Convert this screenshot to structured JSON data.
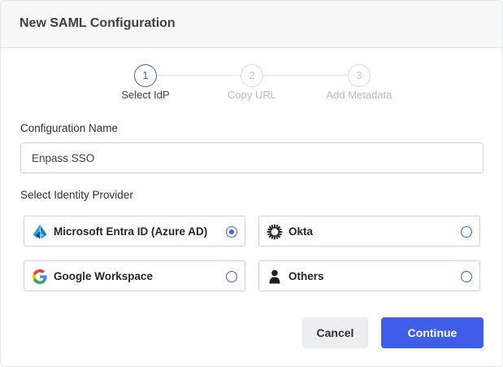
{
  "dialog": {
    "title": "New SAML Configuration"
  },
  "stepper": {
    "steps": [
      {
        "number": "1",
        "label": "Select IdP",
        "active": true
      },
      {
        "number": "2",
        "label": "Copy URL",
        "active": false
      },
      {
        "number": "3",
        "label": "Add Metadata",
        "active": false
      }
    ]
  },
  "form": {
    "config_name_label": "Configuration Name",
    "config_name_value": "Enpass SSO",
    "idp_label": "Select Identity Provider",
    "providers": [
      {
        "name": "Microsoft Entra ID (Azure AD)",
        "icon": "azure-icon",
        "selected": true
      },
      {
        "name": "Okta",
        "icon": "okta-icon",
        "selected": false
      },
      {
        "name": "Google Workspace",
        "icon": "google-icon",
        "selected": false
      },
      {
        "name": "Others",
        "icon": "user-icon",
        "selected": false
      }
    ]
  },
  "actions": {
    "cancel_label": "Cancel",
    "continue_label": "Continue"
  },
  "colors": {
    "accent": "#3f5de9",
    "header_bg": "#f7f7f8",
    "cancel_bg": "#eceef1"
  }
}
